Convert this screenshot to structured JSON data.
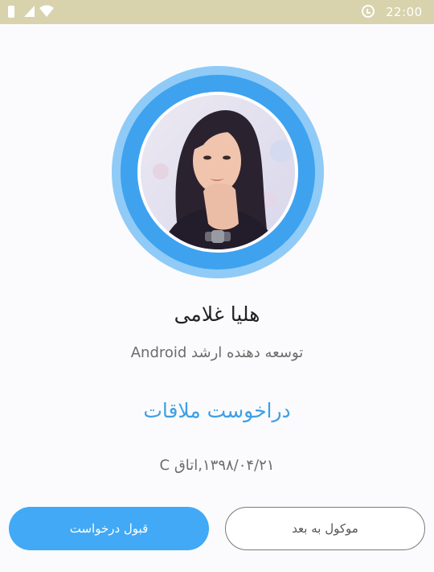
{
  "status_bar": {
    "time": "22:00",
    "icons": [
      "battery-icon",
      "sim-signal-icon",
      "wifi-icon",
      "alarm-clock-icon"
    ]
  },
  "profile": {
    "name": "هلیا غلامی",
    "role": "توسعه دهنده ارشد Android",
    "avatar": "profile-photo"
  },
  "meeting": {
    "title": "دراخوست ملاقات",
    "info": "۱۳۹۸/۰۴/۲۱,اتاق C"
  },
  "actions": {
    "accept_label": "قبول درخواست",
    "later_label": "موکول به بعد"
  },
  "colors": {
    "status_bar": "#d8d3ad",
    "accent": "#41a9f5",
    "ring_outer": "#8fcbf6",
    "ring_inner": "#3ea2ef",
    "title_blue": "#3d9fe6"
  }
}
